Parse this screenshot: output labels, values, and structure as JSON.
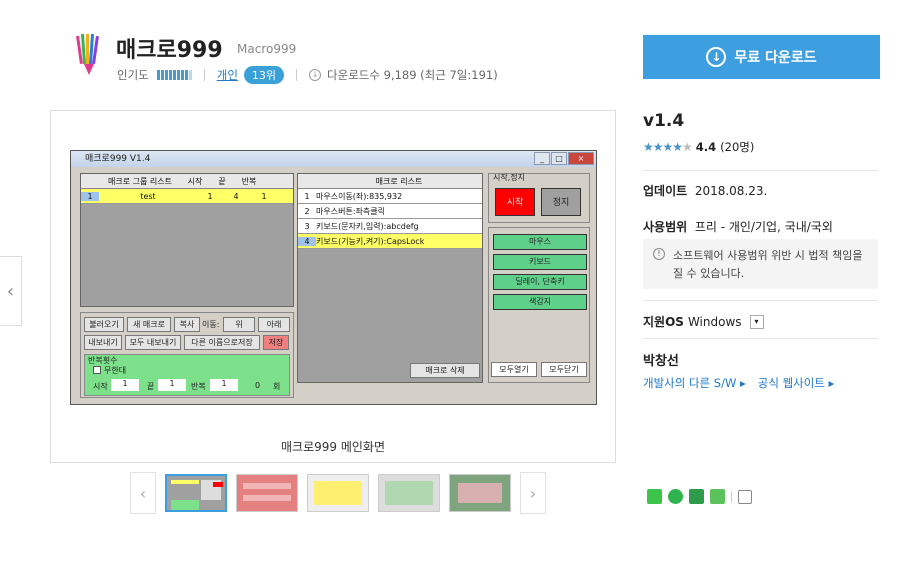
{
  "header": {
    "title": "매크로999",
    "subtitle": "Macro999",
    "popularity_label": "인기도",
    "category": "개인",
    "rank": "13위",
    "downloads": "다운로드수 9,189 (최근 7일:191)"
  },
  "download_button": {
    "label": "무료 다운로드"
  },
  "screenshot": {
    "caption": "매크로999 메인화면",
    "app": {
      "window_title": "매크로999 V1.4",
      "group_headers": [
        "매크로 그룹 리스트",
        "시작",
        "끝",
        "반복"
      ],
      "group_rows": [
        {
          "idx": "1",
          "name": "test",
          "start": "1",
          "end": "4",
          "repeat": "1"
        }
      ],
      "macro_header": "매크로 리스트",
      "macro_rows": [
        {
          "idx": "1",
          "text": "마우스이동(좌):835,932"
        },
        {
          "idx": "2",
          "text": "마우스버튼:좌측클릭"
        },
        {
          "idx": "3",
          "text": "키보드(문자키,입력):abcdefg"
        },
        {
          "idx": "4",
          "text": "키보드(기능키,켜기):CapsLock"
        }
      ],
      "btn_load": "불러오기",
      "btn_new": "새 매크로",
      "btn_copy": "복사",
      "move_label": "이동:",
      "btn_up": "위",
      "btn_down": "아래",
      "btn_export": "내보내기",
      "btn_export_all": "모두 내보내기",
      "btn_saveas": "다른 이름으로저장",
      "btn_save": "저장",
      "repeat_title": "반복횟수",
      "infinite": "무한대",
      "start_label": "시작",
      "start_val": "1",
      "end_label": "끝",
      "end_val": "1",
      "repeat_label": "반복",
      "repeat_val": "1",
      "count_val": "0",
      "count_unit": "회",
      "btn_delete_macro": "매크로 삭제",
      "startstop_label": "시작,정지",
      "btn_start": "시작",
      "btn_stop": "정지",
      "side_buttons": [
        "마우스",
        "키보드",
        "딜레이, 단축키",
        "색감지"
      ],
      "btn_open_all": "모두열기",
      "btn_close_all": "모두닫기"
    }
  },
  "info": {
    "version": "v1.4",
    "rating": "4.4",
    "rating_count": "(20명)",
    "update_label": "업데이트",
    "update_value": "2018.08.23.",
    "scope_label": "사용범위",
    "scope_value": "프리 - 개인/기업, 국내/국외",
    "warning": "소프트웨어 사용범위 위반 시 법적 책임을 질 수 있습니다.",
    "os_label": "지원OS",
    "os_value": "Windows",
    "developer": "박창선",
    "dev_link1": "개발사의 다른 S/W",
    "dev_link2": "공식 웹사이트"
  },
  "colors": {
    "accent": "#3d9ee0",
    "highlight": "#ffff66",
    "start_red": "#ff0000",
    "green": "#5fd08a"
  }
}
